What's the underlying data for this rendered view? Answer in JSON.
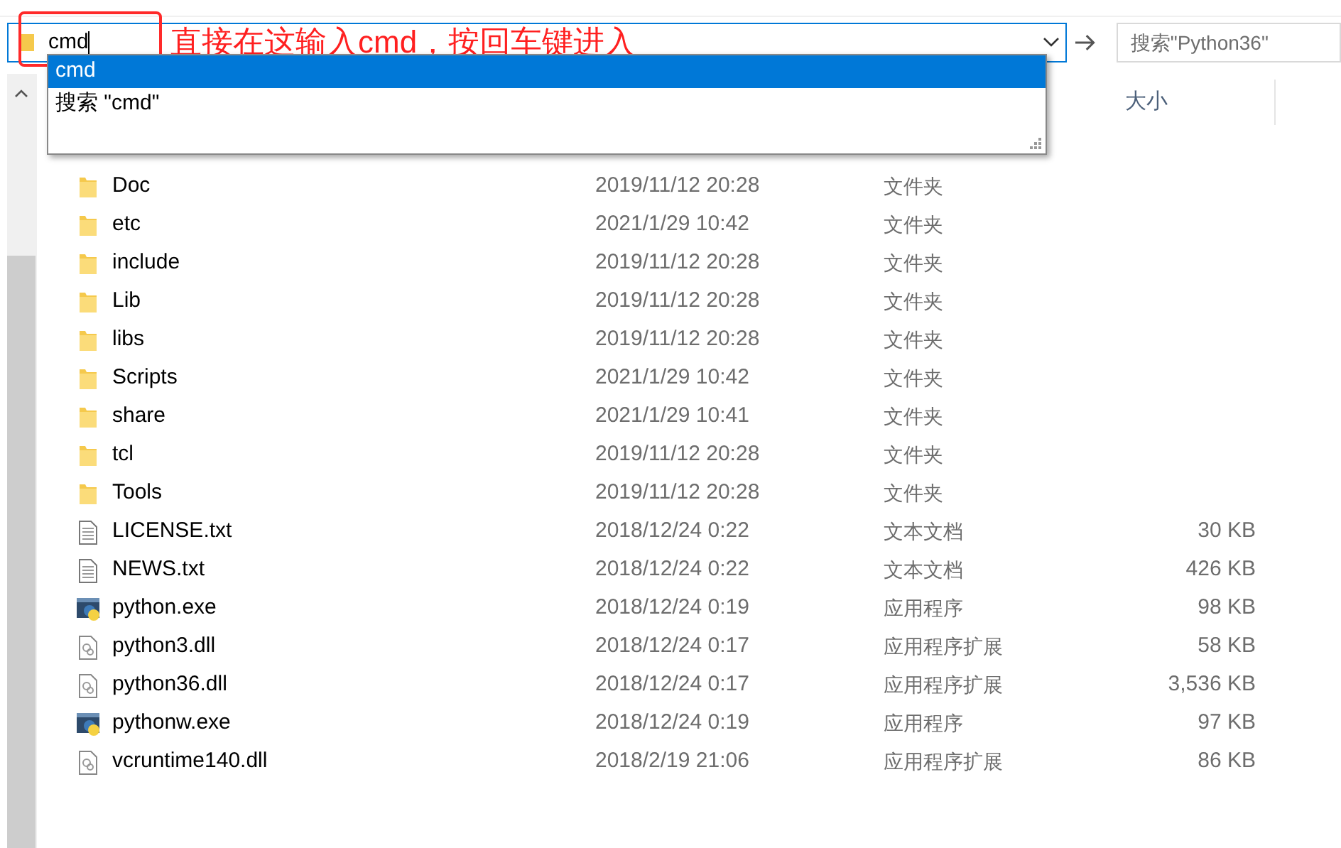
{
  "address_bar": {
    "value": "cmd"
  },
  "search": {
    "placeholder": "搜索\"Python36\""
  },
  "annotation": {
    "text": "直接在这输入cmd，按回车键进入"
  },
  "suggestions": [
    {
      "label": "cmd",
      "selected": true
    },
    {
      "label": "搜索 \"cmd\"",
      "selected": false
    }
  ],
  "columns": {
    "column_4": "大小"
  },
  "files": [
    {
      "kind": "folder",
      "name": "Doc",
      "date": "2019/11/12 20:28",
      "type": "文件夹"
    },
    {
      "kind": "folder",
      "name": "etc",
      "date": "2021/1/29 10:42",
      "type": "文件夹"
    },
    {
      "kind": "folder",
      "name": "include",
      "date": "2019/11/12 20:28",
      "type": "文件夹"
    },
    {
      "kind": "folder",
      "name": "Lib",
      "date": "2019/11/12 20:28",
      "type": "文件夹"
    },
    {
      "kind": "folder",
      "name": "libs",
      "date": "2019/11/12 20:28",
      "type": "文件夹"
    },
    {
      "kind": "folder",
      "name": "Scripts",
      "date": "2021/1/29 10:42",
      "type": "文件夹"
    },
    {
      "kind": "folder",
      "name": "share",
      "date": "2021/1/29 10:41",
      "type": "文件夹"
    },
    {
      "kind": "folder",
      "name": "tcl",
      "date": "2019/11/12 20:28",
      "type": "文件夹"
    },
    {
      "kind": "folder",
      "name": "Tools",
      "date": "2019/11/12 20:28",
      "type": "文件夹"
    },
    {
      "kind": "text",
      "name": "LICENSE.txt",
      "date": "2018/12/24 0:22",
      "type": "文本文档",
      "size": "30 KB"
    },
    {
      "kind": "text",
      "name": "NEWS.txt",
      "date": "2018/12/24 0:22",
      "type": "文本文档",
      "size": "426 KB"
    },
    {
      "kind": "exe",
      "name": "python.exe",
      "date": "2018/12/24 0:19",
      "type": "应用程序",
      "size": "98 KB"
    },
    {
      "kind": "dll",
      "name": "python3.dll",
      "date": "2018/12/24 0:17",
      "type": "应用程序扩展",
      "size": "58 KB"
    },
    {
      "kind": "dll",
      "name": "python36.dll",
      "date": "2018/12/24 0:17",
      "type": "应用程序扩展",
      "size": "3,536 KB"
    },
    {
      "kind": "exe",
      "name": "pythonw.exe",
      "date": "2018/12/24 0:19",
      "type": "应用程序",
      "size": "97 KB"
    },
    {
      "kind": "dll",
      "name": "vcruntime140.dll",
      "date": "2018/2/19 21:06",
      "type": "应用程序扩展",
      "size": "86 KB"
    }
  ]
}
